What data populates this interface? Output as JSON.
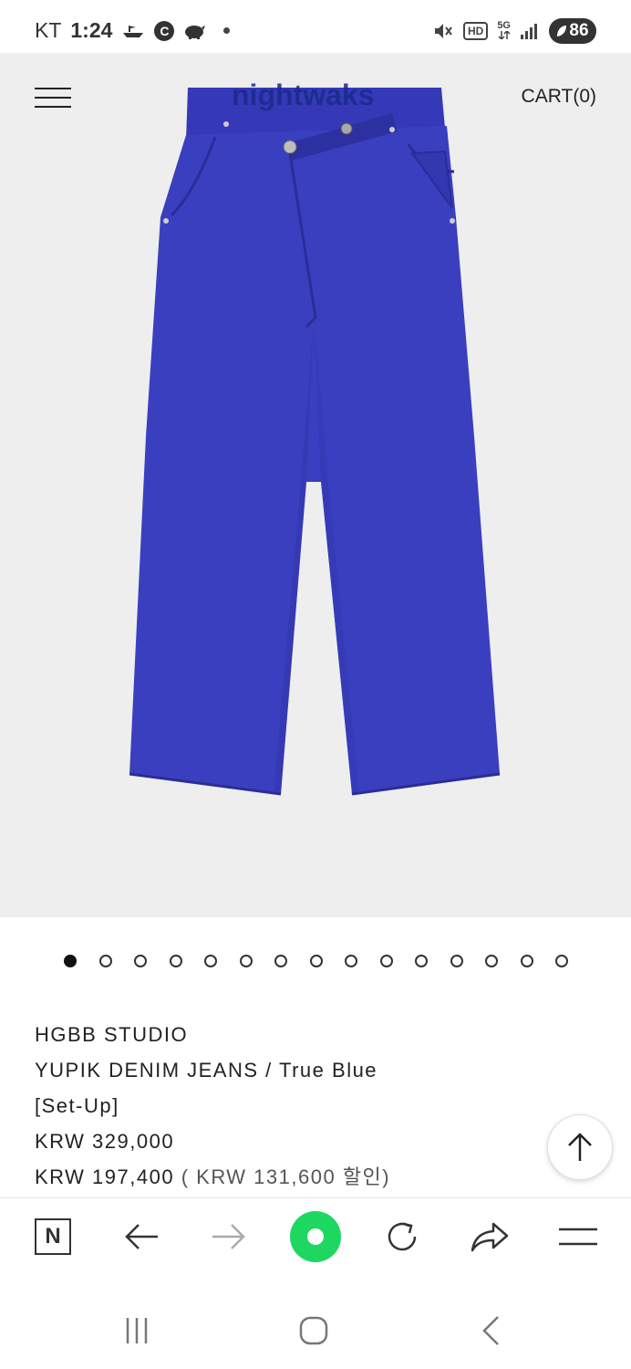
{
  "status_bar": {
    "carrier": "KT",
    "time": "1:24",
    "hd_label": "HD",
    "network_label": "5G",
    "battery": "86"
  },
  "header": {
    "logo": "nightwaks",
    "cart_label": "CART(0)"
  },
  "carousel": {
    "total_slides": 15,
    "active_index": 0
  },
  "product": {
    "brand": "HGBB STUDIO",
    "name": "YUPIK DENIM JEANS / True Blue",
    "tag": "[Set-Up]",
    "original_price": "KRW 329,000",
    "sale_price": "KRW 197,400",
    "discount_note": "( KRW 131,600 할인)"
  },
  "colors": {
    "denim": "#3a3fc0",
    "image_bg": "#eeeeef",
    "accent_green": "#1ed760"
  },
  "toolbar": {
    "naver_label": "N",
    "icons": [
      "naver-icon",
      "back-arrow-icon",
      "forward-arrow-icon",
      "home-green-icon",
      "refresh-icon",
      "share-icon",
      "menu-icon"
    ]
  }
}
